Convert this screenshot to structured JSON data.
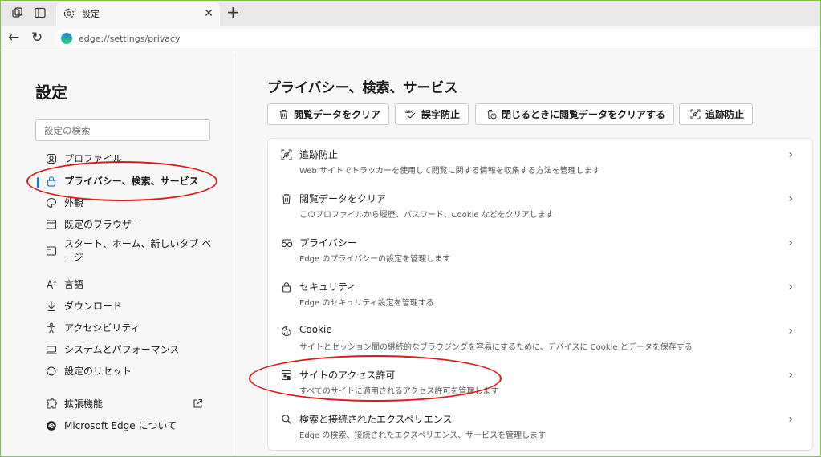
{
  "tab": {
    "title": "設定"
  },
  "address": {
    "url": "edge://settings/privacy"
  },
  "sidebar": {
    "title": "設定",
    "search_placeholder": "設定の検索",
    "items": [
      {
        "label": "プロファイル",
        "icon": "profile-icon"
      },
      {
        "label": "プライバシー、検索、サービス",
        "icon": "lock-icon",
        "active": true
      },
      {
        "label": "外観",
        "icon": "appearance-icon"
      },
      {
        "label": "既定のブラウザー",
        "icon": "browser-icon"
      },
      {
        "label": "スタート、ホーム、新しいタブ ペ",
        "label2": "ージ",
        "icon": "home-icon"
      },
      {
        "label": "言語",
        "icon": "language-icon"
      },
      {
        "label": "ダウンロード",
        "icon": "download-icon"
      },
      {
        "label": "アクセシビリティ",
        "icon": "accessibility-icon"
      },
      {
        "label": "システムとパフォーマンス",
        "icon": "system-icon"
      },
      {
        "label": "設定のリセット",
        "icon": "reset-icon"
      },
      {
        "label": "拡張機能",
        "icon": "extensions-icon"
      },
      {
        "label": "Microsoft Edge について",
        "icon": "edge-icon"
      }
    ]
  },
  "main": {
    "title": "プライバシー、検索、サービス",
    "chips": [
      {
        "label": "閲覧データをクリア",
        "icon": "trash-icon"
      },
      {
        "label": "誤字防止",
        "icon": "spellcheck-icon"
      },
      {
        "label": "閉じるときに閲覧データをクリアする",
        "icon": "trash-clock-icon"
      },
      {
        "label": "追跡防止",
        "icon": "tracking-icon"
      }
    ],
    "rows": [
      {
        "title": "追跡防止",
        "desc": "Web サイトでトラッカーを使用して閲覧に関する情報を収集する方法を管理します",
        "icon": "tracking-icon"
      },
      {
        "title": "閲覧データをクリア",
        "desc": "このプロファイルから履歴、パスワード、Cookie などをクリアします",
        "icon": "trash-icon"
      },
      {
        "title": "プライバシー",
        "desc": "Edge のプライバシーの設定を管理します",
        "icon": "glasses-icon"
      },
      {
        "title": "セキュリティ",
        "desc": "Edge のセキュリティ設定を管理する",
        "icon": "lock-icon"
      },
      {
        "title": "Cookie",
        "desc": "サイトとセッション間の継続的なブラウジングを容易にするために、デバイスに Cookie とデータを保存する",
        "icon": "cookie-icon"
      },
      {
        "title": "サイトのアクセス許可",
        "desc": "すべてのサイトに適用されるアクセス許可を管理します",
        "icon": "site-permissions-icon"
      },
      {
        "title": "検索と接続されたエクスペリエンス",
        "desc": "Edge の検索、接続されたエクスペリエンス、サービスを管理します",
        "icon": "search-icon"
      }
    ]
  },
  "colors": {
    "accent": "#1a73d9",
    "annotation": "#e01818",
    "frame": "#7cc34a"
  }
}
